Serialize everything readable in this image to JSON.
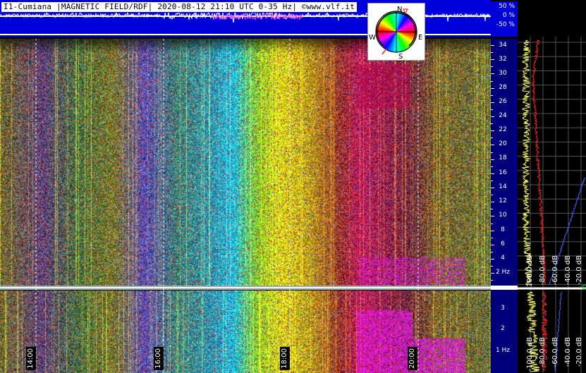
{
  "header": {
    "title": "I1-Cumiana |MAGNETIC FIELD/RDF| 2020-08-12 21:10 UTC 0-35 Hz| ©www.vlf.it"
  },
  "percent_scale": [
    "50 %",
    "0 %",
    "-50 %"
  ],
  "compass": {
    "north": "N",
    "south": "S",
    "east": "E",
    "west": "W"
  },
  "frequency_scale": {
    "main_labels": [
      "34",
      "32",
      "30",
      "28",
      "26",
      "24",
      "22",
      "20",
      "18",
      "16",
      "14",
      "12",
      "10",
      "8",
      "6",
      "4",
      "2 Hz"
    ],
    "low_labels": [
      "3",
      "2",
      "1 Hz"
    ]
  },
  "time_labels": [
    "14:00",
    "16:00",
    "18:00",
    "20:00"
  ],
  "spectrum_db_labels_main": [
    "-100.0 dB",
    "-80.0 dB",
    "-60.0 dB",
    "-40.0 dB",
    "-20.0 dB"
  ],
  "spectrum_db_labels_low": [
    "-100.0 dB",
    "-80.0 dB",
    "-60.0 dB",
    "-40.0 dB",
    "-20.0 dB"
  ],
  "colors": {
    "header_blue": "#0000d8",
    "scale_blue": "#00007a",
    "trace_yellow": "#ffff66",
    "trace_red": "#ff2020",
    "trace_blue": "#4060ff"
  }
}
